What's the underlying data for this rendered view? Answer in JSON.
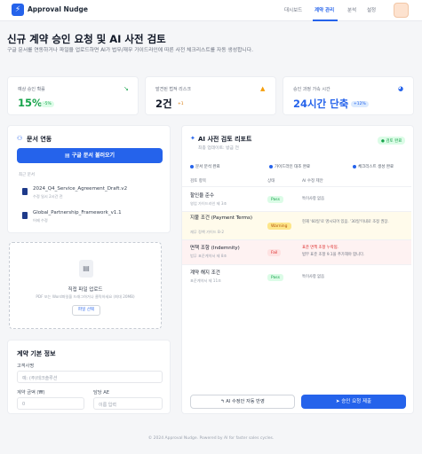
{
  "app": {
    "name": "Approval Nudge",
    "logo_glyph": "⚡",
    "accent": "#2563eb"
  },
  "nav": {
    "items": [
      "대시보드",
      "계약 관리",
      "분석",
      "설정"
    ],
    "active": "계약 관리"
  },
  "page": {
    "title": "신규 계약 승인 요청 및 AI 사전 검토",
    "subtitle": "구글 문서를 연동하거나 파일을 업로드하면 AI가 법무/재무 가이드라인에 따른 사전 체크리스트를 자동 생성합니다."
  },
  "stats": [
    {
      "label": "예상 승인 확률",
      "value": "15%",
      "delta": "-5%",
      "value_color": "#16a34a",
      "icon": "trend-down-icon"
    },
    {
      "label": "발견된 법적 리스크",
      "value": "2건",
      "delta": "+1",
      "value_color": "#111827",
      "icon": "warning-icon"
    },
    {
      "label": "승인 과정 가속 시간",
      "value": "24시간 단축",
      "delta": "+12%",
      "value_color": "#2563eb",
      "icon": "speed-icon"
    }
  ],
  "doc_link": {
    "title": "문서 연동",
    "google_button": "구글 문서 불러오기",
    "recent_label": "최근 문서",
    "files": [
      {
        "name": "2024_Q4_Service_Agreement_Draft.v2",
        "meta": "수정 일시 2시간 전"
      },
      {
        "name": "Global_Partnership_Framework_v1.1",
        "meta": "어제 수정"
      }
    ]
  },
  "upload": {
    "title": "직접 파일 업로드",
    "hint": "PDF 또는 Word파일을 드래그하거나 클릭하세요 (최대 20MB)",
    "button": "파일 선택"
  },
  "contract_info": {
    "title": "계약 기본 정보",
    "fields": [
      {
        "label": "고객사명",
        "placeholder": "예: (주)테크솔루션"
      },
      {
        "label": "계약 금액 (₩)",
        "placeholder": "0"
      },
      {
        "label": "담당 AE",
        "placeholder": "이름 입력"
      }
    ]
  },
  "review": {
    "title": "AI 사전 검토 리포트",
    "subtitle": "최종 업데이트: 방금 전",
    "badge": "● 검토 완료",
    "steps": [
      "문서 분석 완료",
      "가이드라인 대조 완료",
      "체크리스트 생성 완료"
    ],
    "columns": [
      "검토 항목",
      "상태",
      "AI 수정 제안"
    ],
    "rows": [
      {
        "name": "할인율 준수",
        "ref": "영업 가이드라인 제 3조",
        "status": "Pass",
        "kind": "pass",
        "suggest": "특이사항 없음"
      },
      {
        "name": "지불 조건 (Payment Terms)",
        "ref": "재무 정책 가이드 B-2",
        "status": "Warning",
        "kind": "warning",
        "suggest": "현재 '60일'로 명시되어 있음. '30일'이내로 조정 권장."
      },
      {
        "name": "면책 조항 (Indemnity)",
        "ref": "법무 표준계약서 제 8조",
        "status": "Fail",
        "kind": "fail",
        "suggest": "표준 면책 조항 누락됨.",
        "suggest2": "법무 표준 조항 9.1을 추가해야 합니다."
      },
      {
        "name": "계약 해지 조건",
        "ref": "표준계약서 제 11조",
        "status": "Pass",
        "kind": "pass",
        "suggest": "특이사항 없음"
      }
    ],
    "apply_button": "AI 수정안 자동 반영",
    "submit_button": "승인 요청 제출"
  },
  "footer": "© 2024 Approval Nudge. Powered by AI for faster sales cycles."
}
